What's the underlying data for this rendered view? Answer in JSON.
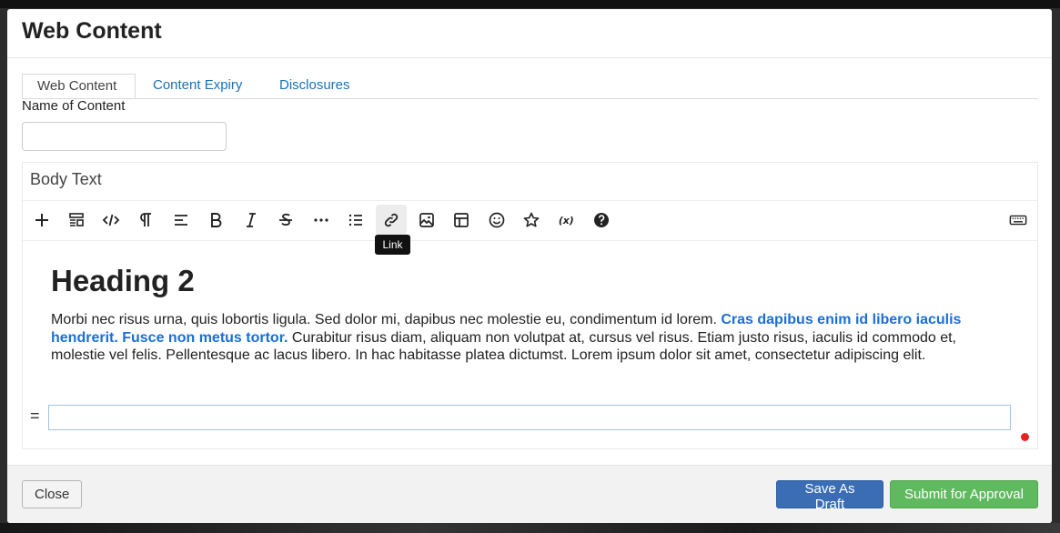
{
  "modal": {
    "title": "Web Content"
  },
  "tabs": [
    {
      "label": "Web Content",
      "active": true
    },
    {
      "label": "Content Expiry",
      "active": false
    },
    {
      "label": "Disclosures",
      "active": false
    }
  ],
  "name_field": {
    "label": "Name of Content",
    "value": "",
    "placeholder": ""
  },
  "editor": {
    "title": "Body Text",
    "toolbar": {
      "buttons": [
        {
          "icon": "plus-icon",
          "label": "Add"
        },
        {
          "icon": "template-icon",
          "label": "Templates"
        },
        {
          "icon": "code-icon",
          "label": "Code"
        },
        {
          "icon": "paragraph-icon",
          "label": "Paragraph"
        },
        {
          "icon": "align-icon",
          "label": "Align"
        },
        {
          "icon": "bold-icon",
          "label": "Bold"
        },
        {
          "icon": "italic-icon",
          "label": "Italic"
        },
        {
          "icon": "strikethrough-icon",
          "label": "Strikethrough"
        },
        {
          "icon": "more-icon",
          "label": "More"
        },
        {
          "icon": "list-icon",
          "label": "List"
        },
        {
          "icon": "link-icon",
          "label": "Link"
        },
        {
          "icon": "image-icon",
          "label": "Image"
        },
        {
          "icon": "table-icon",
          "label": "Table"
        },
        {
          "icon": "emoji-icon",
          "label": "Emoji"
        },
        {
          "icon": "star-icon",
          "label": "Special characters"
        },
        {
          "icon": "variable-icon",
          "label": "Variables"
        },
        {
          "icon": "help-icon",
          "label": "Help"
        },
        {
          "icon": "keyboard-icon",
          "label": "Keyboard"
        }
      ],
      "tooltip": "Link"
    },
    "content": {
      "heading": "Heading 2",
      "paragraph_plain_1": "Morbi nec risus urna, quis lobortis ligula. Sed dolor mi, dapibus nec molestie eu, condimentum id lorem. ",
      "paragraph_bold": "Cras dapibus enim id libero iaculis hendrerit. Fusce non metus tortor.",
      "paragraph_plain_2": " Curabitur risus diam, aliquam non volutpat at, cursus vel risus. Etiam justo risus, iaculis id commodo et, molestie vel felis. Pellentesque ac lacus libero. In hac habitasse platea dictumst. Lorem ipsum dolor sit amet, consectetur adipiscing elit.",
      "drag_handle": "="
    },
    "status_color": "#e5231f"
  },
  "footer": {
    "close_label": "Close",
    "draft_label": "Save As Draft",
    "submit_label": "Submit for Approval"
  },
  "colors": {
    "link_blue": "#1a72b5",
    "primary_button": "#3a6db4",
    "success_button": "#5fba5f",
    "bold_text": "#1a6fd6"
  }
}
